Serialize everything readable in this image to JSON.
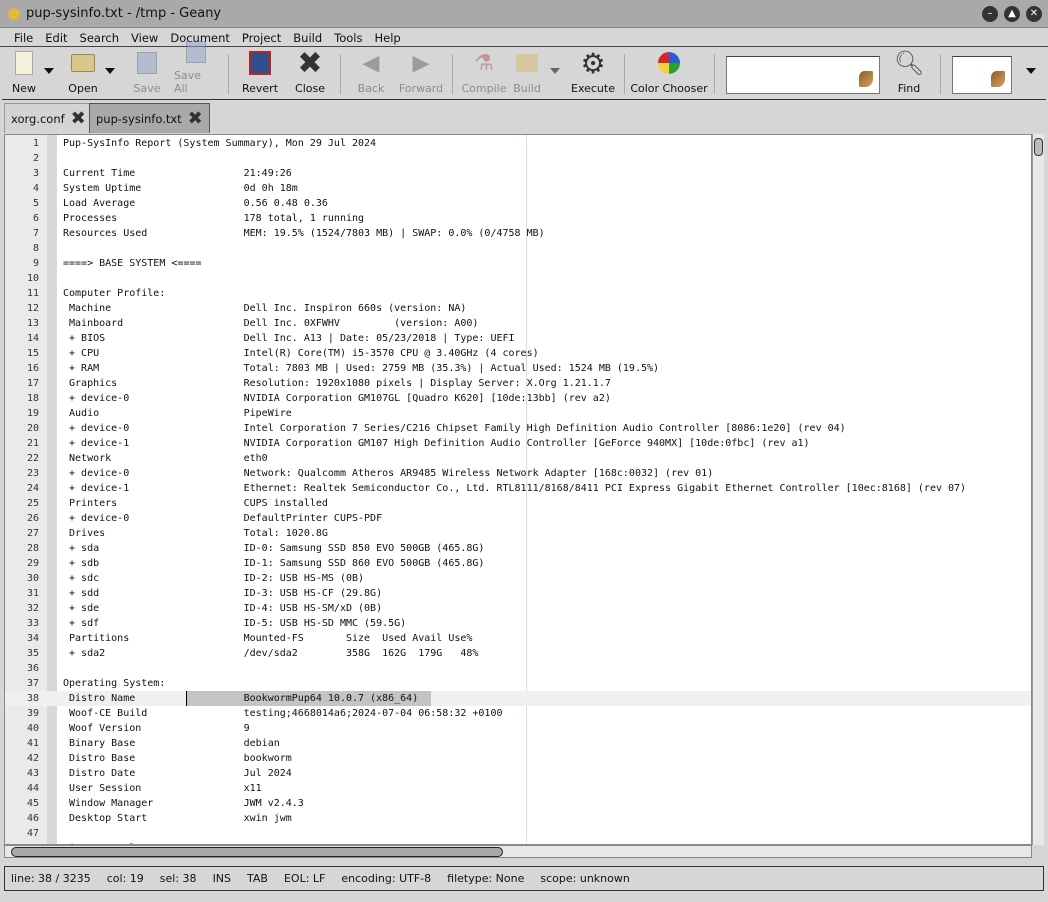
{
  "window": {
    "title": "pup-sysinfo.txt - /tmp - Geany",
    "controls": [
      "minimize",
      "maximize",
      "close"
    ]
  },
  "menu": [
    "File",
    "Edit",
    "Search",
    "View",
    "Document",
    "Project",
    "Build",
    "Tools",
    "Help"
  ],
  "toolbar": {
    "new": "New",
    "open": "Open",
    "save": "Save",
    "save_all": "Save All",
    "revert": "Revert",
    "close": "Close",
    "back": "Back",
    "forward": "Forward",
    "compile": "Compile",
    "build": "Build",
    "execute": "Execute",
    "color_chooser": "Color Chooser",
    "find": "Find",
    "search_value": "",
    "goto_value": ""
  },
  "tabs": [
    {
      "label": "xorg.conf",
      "active": false
    },
    {
      "label": "pup-sysinfo.txt",
      "active": true
    }
  ],
  "editor": {
    "current_line": 38,
    "lines": [
      "Pup-SysInfo Report (System Summary), Mon 29 Jul 2024",
      "",
      "Current Time                  21:49:26",
      "System Uptime                 0d 0h 18m",
      "Load Average                  0.56 0.48 0.36",
      "Processes                     178 total, 1 running",
      "Resources Used                MEM: 19.5% (1524/7803 MB) | SWAP: 0.0% (0/4758 MB)",
      "",
      "====> BASE SYSTEM <====",
      "",
      "Computer Profile:",
      " Machine                      Dell Inc. Inspiron 660s (version: NA)",
      " Mainboard                    Dell Inc. 0XFWHV         (version: A00)",
      " + BIOS                       Dell Inc. A13 | Date: 05/23/2018 | Type: UEFI",
      " + CPU                        Intel(R) Core(TM) i5-3570 CPU @ 3.40GHz (4 cores)",
      " + RAM                        Total: 7803 MB | Used: 2759 MB (35.3%) | Actual Used: 1524 MB (19.5%)",
      " Graphics                     Resolution: 1920x1080 pixels | Display Server: X.Org 1.21.1.7",
      " + device-0                   NVIDIA Corporation GM107GL [Quadro K620] [10de:13bb] (rev a2)",
      " Audio                        PipeWire",
      " + device-0                   Intel Corporation 7 Series/C216 Chipset Family High Definition Audio Controller [8086:1e20] (rev 04)",
      " + device-1                   NVIDIA Corporation GM107 High Definition Audio Controller [GeForce 940MX] [10de:0fbc] (rev a1)",
      " Network                      eth0",
      " + device-0                   Network: Qualcomm Atheros AR9485 Wireless Network Adapter [168c:0032] (rev 01)",
      " + device-1                   Ethernet: Realtek Semiconductor Co., Ltd. RTL8111/8168/8411 PCI Express Gigabit Ethernet Controller [10ec:8168] (rev 07)",
      " Printers                     CUPS installed",
      " + device-0                   DefaultPrinter CUPS-PDF",
      " Drives                       Total: 1020.8G",
      " + sda                        ID-0: Samsung SSD 850 EVO 500GB (465.8G)",
      " + sdb                        ID-1: Samsung SSD 860 EVO 500GB (465.8G)",
      " + sdc                        ID-2: USB HS-MS (0B)",
      " + sdd                        ID-3: USB HS-CF (29.8G)",
      " + sde                        ID-4: USB HS-SM/xD (0B)",
      " + sdf                        ID-5: USB HS-SD MMC (59.5G)",
      " Partitions                   Mounted-FS       Size  Used Avail Use%",
      " + sda2                       /dev/sda2        358G  162G  179G   48%",
      "",
      "Operating System:",
      " Distro Name                  BookwormPup64 10.0.7 (x86_64)",
      " Woof-CE Build                testing;4668014a6;2024-07-04 06:58:32 +0100",
      " Woof Version                 9",
      " Binary Base                  debian",
      " Distro Base                  bookworm",
      " Distro Date                  Jul 2024",
      " User Session                 x11",
      " Window Manager               JWM v2.4.3",
      " Desktop Start                xwin jwm",
      "",
      "Linux Kernel:"
    ]
  },
  "status": [
    "line: 38 / 3235",
    "col: 19",
    "sel: 38",
    "INS",
    "TAB",
    "EOL: LF",
    "encoding: UTF-8",
    "filetype: None",
    "scope: unknown"
  ]
}
